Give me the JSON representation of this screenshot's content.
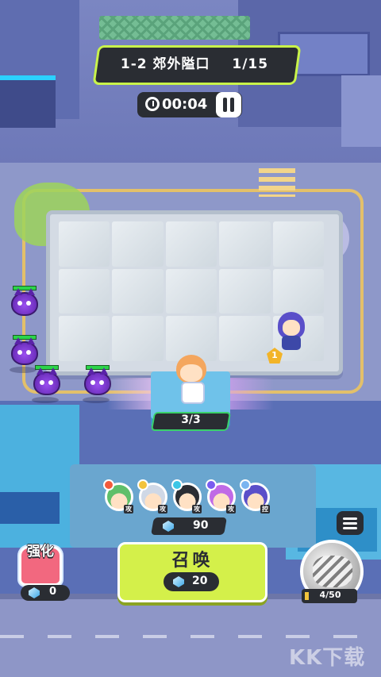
{
  "hud": {
    "stage_label": "1-2 郊外隘口",
    "wave_label": "1/15",
    "timer": "00:04",
    "pause_icon": "pause-icon",
    "clock_icon": "clock-icon"
  },
  "board": {
    "rows": 3,
    "cols": 5
  },
  "field": {
    "capacity_label": "3/3",
    "rank_badge": "1"
  },
  "roster": {
    "heroes": [
      {
        "tag": "攻",
        "badge_color": "#f25a3c",
        "hair": "#5fbf6a"
      },
      {
        "tag": "攻",
        "badge_color": "#f2c33c",
        "hair": "#cfd8e6"
      },
      {
        "tag": "攻",
        "badge_color": "#3cc6e6",
        "hair": "#2a2d33"
      },
      {
        "tag": "攻",
        "badge_color": "#7a5cf0",
        "hair": "#c06ae6"
      },
      {
        "tag": "控",
        "badge_color": "#7ab4f0",
        "hair": "#5a4fc9"
      }
    ]
  },
  "economy": {
    "gem_count": "90",
    "summon_label": "召唤",
    "summon_cost": "20",
    "enhance_label": "强化",
    "enhance_cost": "0"
  },
  "skill": {
    "energy_label": "4/50",
    "energy_fraction": 0.08
  },
  "watermark": "KK下载",
  "colors": {
    "accent": "#d4f04a",
    "panel": "#2a2d33",
    "hp": "#2bd44a",
    "enemy": "#9b4ff0"
  }
}
